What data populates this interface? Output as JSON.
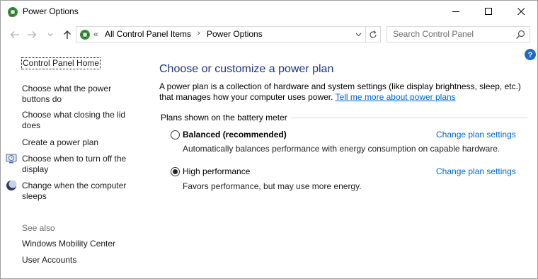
{
  "window": {
    "title": "Power Options"
  },
  "address": {
    "overflow": "«",
    "crumbs": [
      "All Control Panel Items",
      "Power Options"
    ],
    "separator": "›"
  },
  "search": {
    "placeholder": "Search Control Panel"
  },
  "left_pane": {
    "home": "Control Panel Home",
    "links": [
      "Choose what the power buttons do",
      "Choose what closing the lid does",
      "Create a power plan",
      "Choose when to turn off the display",
      "Change when the computer sleeps"
    ],
    "see_also_heading": "See also",
    "see_also": [
      "Windows Mobility Center",
      "User Accounts"
    ]
  },
  "main": {
    "title": "Choose or customize a power plan",
    "intro": "A power plan is a collection of hardware and system settings (like display brightness, sleep, etc.) that manages how your computer uses power.",
    "intro_link": "Tell me more about power plans",
    "group_label": "Plans shown on the battery meter",
    "plans": [
      {
        "name": "Balanced (recommended)",
        "description": "Automatically balances performance with energy consumption on capable hardware.",
        "link": "Change plan settings",
        "selected": false
      },
      {
        "name": "High performance",
        "description": "Favors performance, but may use more energy.",
        "link": "Change plan settings",
        "selected": true
      }
    ]
  },
  "icons": {
    "app": "power-options-icon",
    "back": "back-arrow-icon",
    "forward": "forward-arrow-icon",
    "up": "up-arrow-icon",
    "refresh": "refresh-icon",
    "search": "search-icon",
    "help": "help-icon",
    "display": "display-timer-icon",
    "sleep": "sleep-moon-icon"
  },
  "colors": {
    "link": "#0066cc",
    "title": "#1e3287",
    "help": "#1f6bc4"
  }
}
